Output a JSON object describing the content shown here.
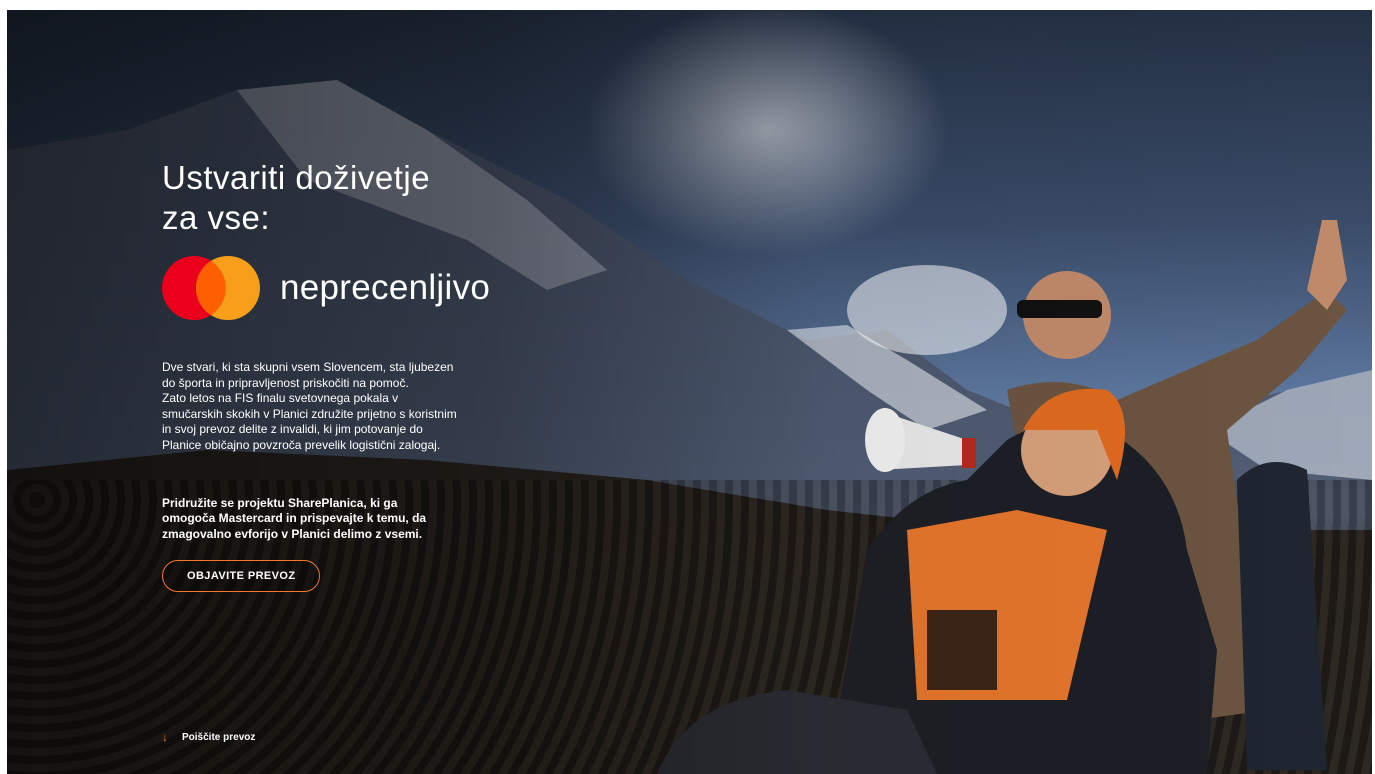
{
  "hero": {
    "headline_line1": "Ustvariti doživetje",
    "headline_line2": "za vse:",
    "tagline": "neprecenljivo",
    "body_lines": [
      "Dve stvari, ki sta skupni vsem Slovencem, sta ljubezen",
      "do športa in pripravljenost priskočiti na pomoč.",
      "Zato letos na FIS finalu svetovnega pokala v",
      "smučarskih skokih v Planici združite prijetno s koristnim",
      "in svoj prevoz delite z invalidi, ki jim potovanje do",
      "Planice običajno povzroča prevelik logistični zalogaj."
    ],
    "cta_lines": [
      "Pridružite se projektu SharePlanica, ki ga",
      "omogoča Mastercard in prispevajte k temu, da",
      "zmagovalno evforijo v Planici delimo z vsemi."
    ],
    "button_label": "OBJAVITE PREVOZ",
    "scroll_link_label": "Poiščite prevoz",
    "scroll_icon": "arrow-down-icon"
  },
  "brand": {
    "logo": "mastercard-logo",
    "red": "#eb001b",
    "orange": "#f79e1b",
    "overlap": "#ff5f00",
    "accent": "#f5782a"
  }
}
